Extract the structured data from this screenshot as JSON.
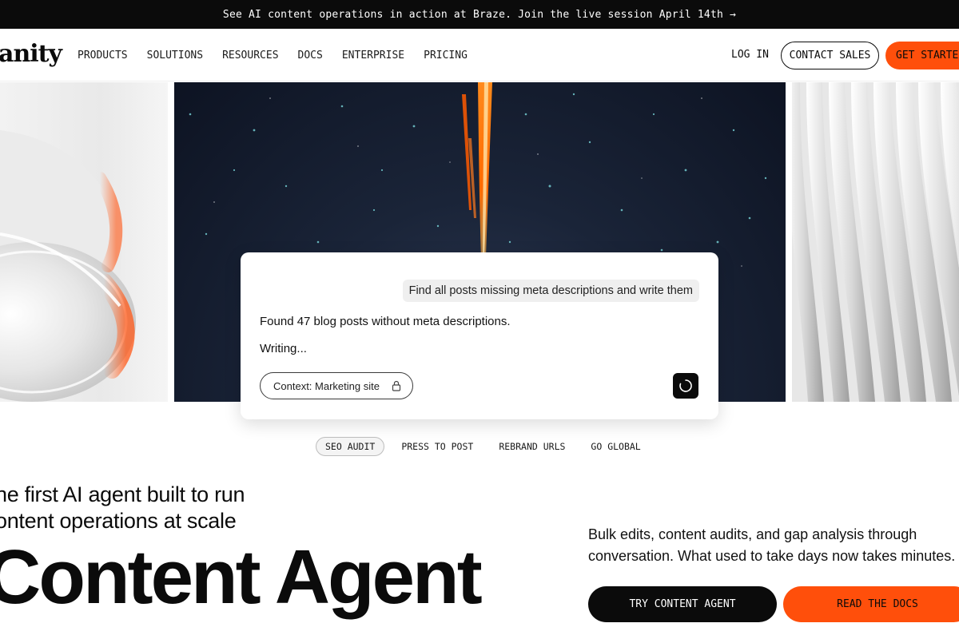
{
  "announcement": {
    "text": "See AI content operations in action at Braze. Join the live session April 14th →"
  },
  "header": {
    "logo": "anity",
    "nav": [
      "PRODUCTS",
      "SOLUTIONS",
      "RESOURCES",
      "DOCS",
      "ENTERPRISE",
      "PRICING"
    ],
    "login": "LOG IN",
    "contact_sales": "CONTACT SALES",
    "get_started": "GET STARTED"
  },
  "chat": {
    "prompt": "Find all posts missing meta descriptions and write them",
    "reply": "Found 47 blog posts without meta descriptions.",
    "status": "Writing...",
    "context": "Context: Marketing site"
  },
  "tabs": {
    "items": [
      "SEO AUDIT",
      "PRESS TO POST",
      "REBRAND URLS",
      "GO GLOBAL"
    ],
    "active": "SEO AUDIT"
  },
  "hero": {
    "subhead": "he first AI agent built to run\nontent operations at scale",
    "title": "Content Agent",
    "description": "Bulk edits, content audits, and gap analysis through\nconversation. What used to take days now takes minutes.",
    "cta_primary": "TRY CONTENT AGENT",
    "cta_secondary": "READ THE DOCS"
  },
  "colors": {
    "accent": "#ff4f0b",
    "dark": "#0b0b0b",
    "bar_background": "#0b0b0b"
  },
  "icons": [
    "lock-icon",
    "spinner-icon",
    "arrow-right-icon"
  ]
}
